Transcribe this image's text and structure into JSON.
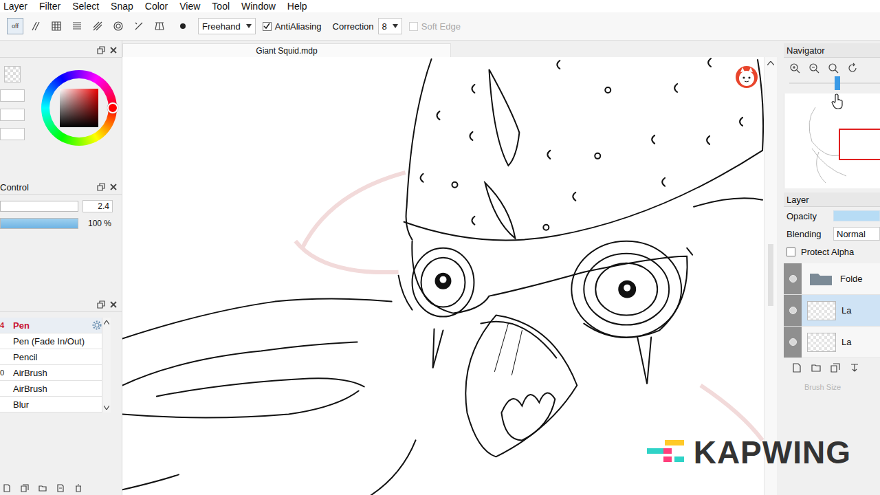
{
  "window": {
    "title": "Giant Squid.mdp"
  },
  "menu": [
    "Layer",
    "Filter",
    "Select",
    "Snap",
    "Color",
    "View",
    "Tool",
    "Window",
    "Help"
  ],
  "toolbar": {
    "snap_off": {
      "label": "off",
      "selected": true
    },
    "mode": "Freehand",
    "antialiasing": {
      "label": "AntiAliasing",
      "checked": true
    },
    "correction": {
      "label": "Correction",
      "value": "8"
    },
    "soft_edge": {
      "label": "Soft Edge",
      "checked": false,
      "disabled": true
    }
  },
  "control_panel": {
    "title": "Control",
    "size": "2.4",
    "size_level": 0.0,
    "opacity": "100 %",
    "opacity_level": 1.0
  },
  "brushes": [
    {
      "name": "Pen",
      "number": "4",
      "selected": true
    },
    {
      "name": "Pen (Fade In/Out)",
      "number": "",
      "selected": false
    },
    {
      "name": "Pencil",
      "number": "",
      "selected": false
    },
    {
      "name": "AirBrush",
      "number": "0",
      "selected": false
    },
    {
      "name": "AirBrush",
      "number": "",
      "selected": false
    },
    {
      "name": "Blur",
      "number": "",
      "selected": false
    }
  ],
  "navigator": {
    "title": "Navigator",
    "zoom_level": 0.5
  },
  "layer_panel": {
    "title": "Layer",
    "opacity_label": "Opacity",
    "opacity_level": 1.0,
    "blending_label": "Blending",
    "blending": "Normal",
    "protect_alpha": {
      "label": "Protect Alpha",
      "checked": false
    },
    "layers": [
      {
        "name": "Folde",
        "kind": "folder",
        "selected": false
      },
      {
        "name": "La",
        "kind": "layer",
        "selected": true
      },
      {
        "name": "La",
        "kind": "layer",
        "selected": false
      }
    ],
    "brush_size_label": "Brush Size"
  },
  "watermark": "KAPWING"
}
